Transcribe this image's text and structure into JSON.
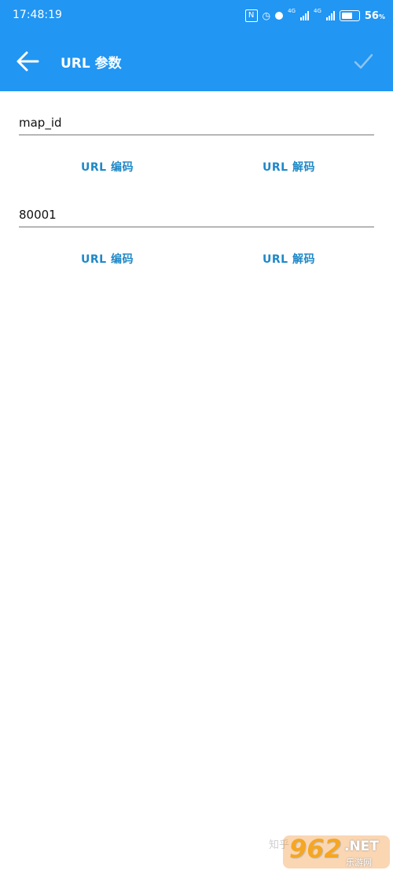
{
  "status_bar": {
    "time": "17:48:19",
    "network_label": "4G",
    "network_label_2": "4G",
    "battery": "56"
  },
  "toolbar": {
    "title": "URL 参数",
    "back_icon": "arrow-left-icon",
    "confirm_icon": "check-icon",
    "color": "#2196f3"
  },
  "params": [
    {
      "value": "map_id",
      "encode_label": "URL 编码",
      "decode_label": "URL 解码"
    },
    {
      "value": "80001",
      "encode_label": "URL 编码",
      "decode_label": "URL 解码"
    }
  ],
  "watermark": {
    "left_text": "知乎",
    "brand": "962",
    "brand_suffix": ".NET",
    "brand_sub": "乐游网"
  }
}
